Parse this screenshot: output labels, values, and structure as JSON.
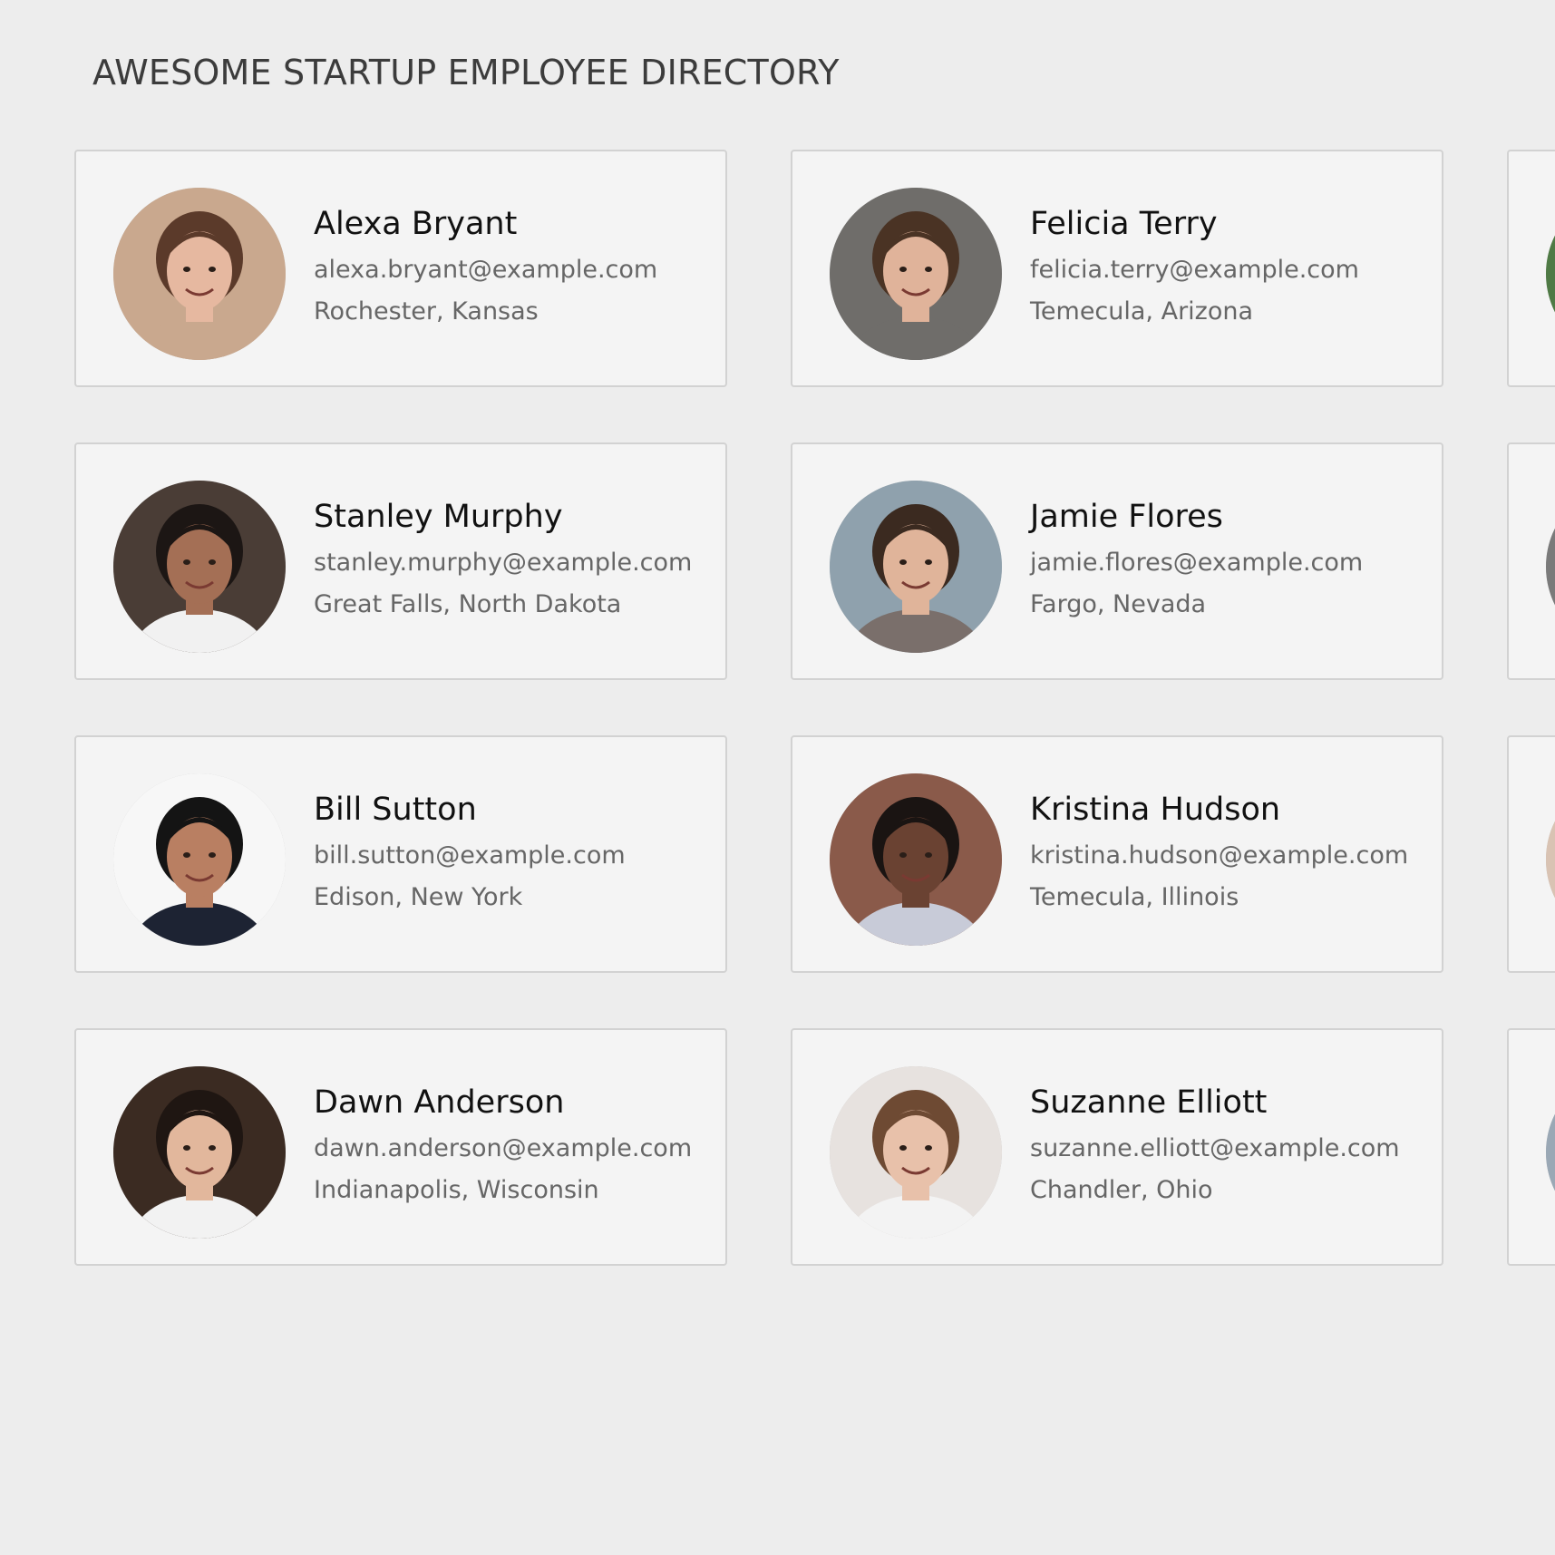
{
  "page": {
    "title": "AWESOME STARTUP EMPLOYEE DIRECTORY"
  },
  "employees": [
    {
      "name": "Alexa Bryant",
      "email": "alexa.bryant@example.com",
      "location": "Rochester, Kansas",
      "avatar_icon": "person-photo-icon",
      "bg": "#c9a88e",
      "skin": "#e6b8a0",
      "hair": "#5b3a2a"
    },
    {
      "name": "Felicia Terry",
      "email": "felicia.terry@example.com",
      "location": "Temecula, Arizona",
      "avatar_icon": "person-photo-icon",
      "bg": "#6f6d6a",
      "skin": "#e0b39a",
      "hair": "#4a3324"
    },
    {
      "name": "",
      "email": "",
      "location": "",
      "avatar_icon": "person-photo-icon",
      "bg": "#4f7a45",
      "skin": "#c99a7a",
      "hair": "#2b2b2b"
    },
    {
      "name": "Stanley Murphy",
      "email": "stanley.murphy@example.com",
      "location": "Great Falls, North Dakota",
      "avatar_icon": "person-photo-icon",
      "bg": "#4a3d36",
      "skin": "#a46f55",
      "hair": "#1c1614",
      "shirt": "#f1f1f1"
    },
    {
      "name": "Jamie Flores",
      "email": "jamie.flores@example.com",
      "location": "Fargo, Nevada",
      "avatar_icon": "person-photo-icon",
      "bg": "#8fa1ad",
      "skin": "#e0b49a",
      "hair": "#3b2a20",
      "shirt": "#7a6f6b"
    },
    {
      "name": "",
      "email": "",
      "location": "",
      "avatar_icon": "person-photo-icon",
      "bg": "#7a7a7a",
      "skin": "#c9a48c",
      "hair": "#3a2a20"
    },
    {
      "name": "Bill Sutton",
      "email": "bill.sutton@example.com",
      "location": "Edison, New York",
      "avatar_icon": "person-photo-icon",
      "bg": "#f7f7f7",
      "skin": "#b97f62",
      "hair": "#141414",
      "shirt": "#1d2333"
    },
    {
      "name": "Kristina Hudson",
      "email": "kristina.hudson@example.com",
      "location": "Temecula, Illinois",
      "avatar_icon": "person-photo-icon",
      "bg": "#8a5a4a",
      "skin": "#6a4232",
      "hair": "#1a1412",
      "shirt": "#c8cbd8"
    },
    {
      "name": "",
      "email": "",
      "location": "",
      "avatar_icon": "person-photo-icon",
      "bg": "#d9c3b3",
      "skin": "#e2c2ad",
      "hair": "#6b4a36"
    },
    {
      "name": "Dawn Anderson",
      "email": "dawn.anderson@example.com",
      "location": "Indianapolis, Wisconsin",
      "avatar_icon": "person-photo-icon",
      "bg": "#3b2b22",
      "skin": "#e2b79c",
      "hair": "#1f1612",
      "shirt": "#f2f2f2"
    },
    {
      "name": "Suzanne Elliott",
      "email": "suzanne.elliott@example.com",
      "location": "Chandler, Ohio",
      "avatar_icon": "person-photo-icon",
      "bg": "#e7e2df",
      "skin": "#e8c1aa",
      "hair": "#6e4a33",
      "shirt": "#f3f3f3"
    },
    {
      "name": "",
      "email": "",
      "location": "",
      "avatar_icon": "person-photo-icon",
      "bg": "#9aa8b5",
      "skin": "#d9b29a",
      "hair": "#4a3a2a"
    }
  ]
}
